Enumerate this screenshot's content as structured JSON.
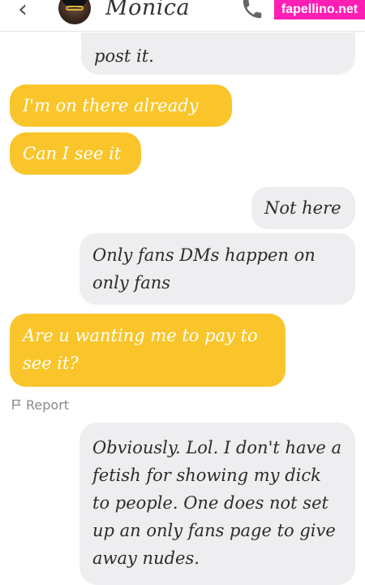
{
  "header": {
    "contact_name": "Monica",
    "watermark": "fapellino.net"
  },
  "messages": [
    {
      "side": "sent",
      "text": "post it."
    },
    {
      "side": "received",
      "text": "I'm on there already"
    },
    {
      "side": "received",
      "text": "Can I see it"
    },
    {
      "side": "sent",
      "text": "Not here"
    },
    {
      "side": "sent",
      "text": "Only fans DMs happen on only fans"
    },
    {
      "side": "received",
      "text": "Are u wanting me to pay to see it?"
    },
    {
      "side": "sent",
      "text": "Obviously. Lol. I don't have a fetish for showing my dick to people. One does not set up an only fans page to give away nudes."
    }
  ],
  "report_label": "Report",
  "colors": {
    "received_bubble": "#f9c52a",
    "sent_bubble": "#eeeef0",
    "watermark_bg": "#ff1fb4"
  }
}
